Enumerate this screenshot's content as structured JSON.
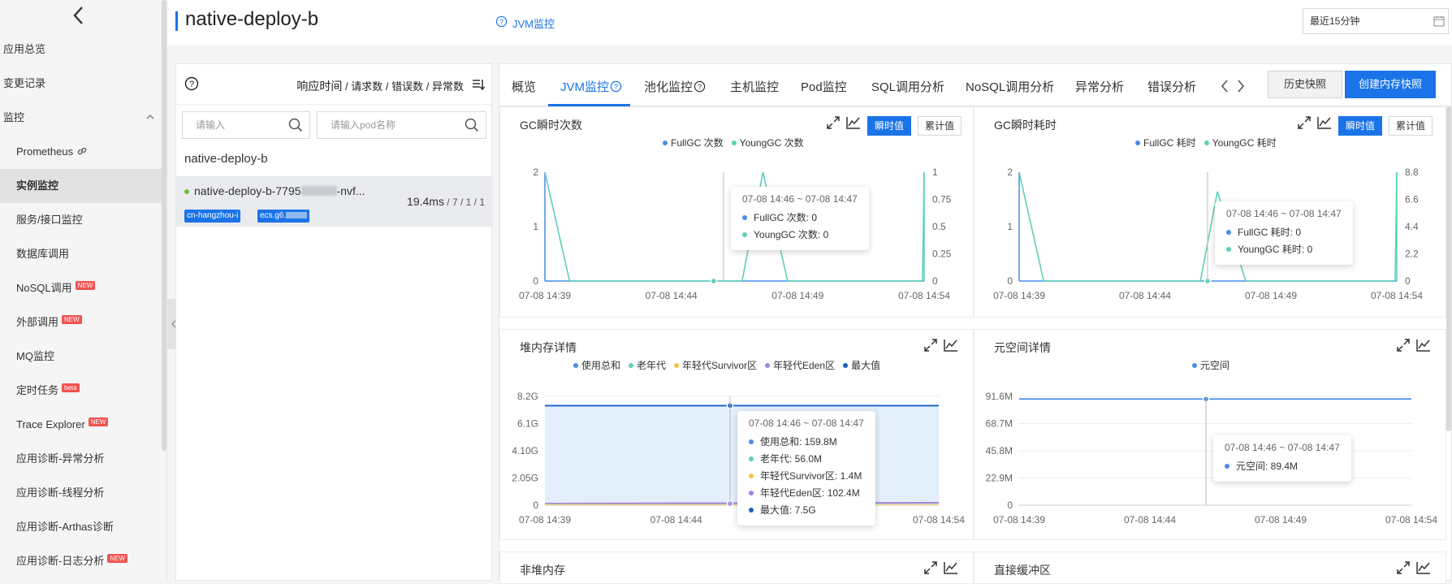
{
  "sidebar": {
    "items": [
      {
        "label": "应用总览",
        "level": "top"
      },
      {
        "label": "变更记录",
        "level": "top"
      },
      {
        "label": "监控",
        "level": "top"
      },
      {
        "label": "Prometheus",
        "level": "sub"
      },
      {
        "label": "实例监控",
        "level": "sub",
        "active": true
      },
      {
        "label": "服务/接口监控",
        "level": "sub"
      },
      {
        "label": "数据库调用",
        "level": "sub"
      },
      {
        "label": "NoSQL调用",
        "level": "sub",
        "badge": "NEW"
      },
      {
        "label": "外部调用",
        "level": "sub",
        "badge": "NEW"
      },
      {
        "label": "MQ监控",
        "level": "sub"
      },
      {
        "label": "定时任务",
        "level": "sub",
        "badge": "beta"
      },
      {
        "label": "Trace Explorer",
        "level": "sub",
        "badge": "NEW"
      },
      {
        "label": "应用诊断-异常分析",
        "level": "sub"
      },
      {
        "label": "应用诊断-线程分析",
        "level": "sub"
      },
      {
        "label": "应用诊断-Arthas诊断",
        "level": "sub"
      },
      {
        "label": "应用诊断-日志分析",
        "level": "sub",
        "badge": "NEW"
      }
    ]
  },
  "header": {
    "title": "native-deploy-b",
    "subtitle": "JVM监控",
    "time_range": "最近15分钟"
  },
  "left": {
    "metrics": {
      "rt": "响应时间",
      "sep": "/",
      "req": "请求数",
      "err": "错误数",
      "exc": "异常数"
    },
    "search_placeholder": "请输入",
    "pod_placeholder": "请输入pod名称",
    "app_name": "native-deploy-b",
    "instance": {
      "name_prefix": "native-deploy-b-7795",
      "name_suffix": "-nvf...",
      "rt": "19.4ms",
      "counts": " / 7 / 1 / 1",
      "tag_region": "cn-hangzhou-i",
      "tag_ecs": "ecs.g6."
    }
  },
  "tabs": [
    "概览",
    "JVM监控",
    "池化监控",
    "主机监控",
    "Pod监控",
    "SQL调用分析",
    "NoSQL调用分析",
    "异常分析",
    "错误分析"
  ],
  "buttons": {
    "history": "历史快照",
    "snapshot": "创建内存快照"
  },
  "toggles": {
    "instant": "瞬时值",
    "cumulative": "累计值"
  },
  "colors": {
    "accent": "#1a74e8",
    "full_gc": "#4a8bea",
    "young_gc": "#5cd0b8",
    "old_gen": "#5cd0b8",
    "survivor": "#f7c244",
    "eden": "#9b87e8",
    "max": "#1660c4"
  },
  "chart_data": [
    {
      "id": "gc-count",
      "type": "line",
      "title": "GC瞬时次数",
      "x": [
        "07-08 14:39",
        "07-08 14:44",
        "07-08 14:49",
        "07-08 14:54"
      ],
      "series": [
        {
          "name": "FullGC 次数",
          "axis": "left",
          "ylim": [
            0,
            2
          ],
          "ticks": [
            "0",
            "1",
            "2"
          ]
        },
        {
          "name": "YoungGC 次数",
          "axis": "right",
          "ylim": [
            0,
            1
          ],
          "ticks": [
            "0",
            "0.25",
            "0.5",
            "0.75",
            "1"
          ]
        }
      ],
      "tooltip": {
        "time": "07-08 14:46 ~ 07-08 14:47",
        "rows": [
          "FullGC 次数:  0",
          "YoungGC 次数:  0"
        ]
      }
    },
    {
      "id": "gc-time",
      "type": "line",
      "title": "GC瞬时耗时",
      "x": [
        "07-08 14:39",
        "07-08 14:44",
        "07-08 14:49",
        "07-08 14:54"
      ],
      "series": [
        {
          "name": "FullGC 耗时",
          "axis": "left",
          "ylim": [
            0,
            2
          ],
          "ticks": [
            "0",
            "1",
            "2"
          ]
        },
        {
          "name": "YoungGC 耗时",
          "axis": "right",
          "ylim": [
            0,
            8.8
          ],
          "ticks": [
            "0",
            "2.2",
            "4.4",
            "6.6",
            "8.8"
          ]
        }
      ],
      "tooltip": {
        "time": "07-08 14:46 ~ 07-08 14:47",
        "rows": [
          "FullGC 耗时:  0",
          "YoungGC 耗时:  0"
        ]
      }
    },
    {
      "id": "heap",
      "type": "area",
      "title": "堆内存详情",
      "x": [
        "07-08 14:39",
        "07-08 14:44",
        "07-08 14:49",
        "07-08 14:54"
      ],
      "yticks": [
        "0",
        "2.05G",
        "4.10G",
        "6.1G",
        "8.2G"
      ],
      "series": [
        {
          "name": "使用总和"
        },
        {
          "name": "老年代"
        },
        {
          "name": "年轻代Survivor区"
        },
        {
          "name": "年轻代Eden区"
        },
        {
          "name": "最大值"
        }
      ],
      "tooltip": {
        "time": "07-08 14:46 ~ 07-08 14:47",
        "rows": [
          "使用总和:  159.8M",
          "老年代:  56.0M",
          "年轻代Survivor区:  1.4M",
          "年轻代Eden区:  102.4M",
          "最大值:  7.5G"
        ]
      }
    },
    {
      "id": "metaspace",
      "type": "line",
      "title": "元空间详情",
      "x": [
        "07-08 14:39",
        "07-08 14:44",
        "07-08 14:49",
        "07-08 14:54"
      ],
      "yticks": [
        "0",
        "22.9M",
        "45.8M",
        "68.7M",
        "91.6M"
      ],
      "series": [
        {
          "name": "元空间"
        }
      ],
      "tooltip": {
        "time": "07-08 14:46 ~ 07-08 14:47",
        "rows": [
          "元空间:  89.4M"
        ]
      }
    },
    {
      "id": "nonheap",
      "title": "非堆内存"
    },
    {
      "id": "direct",
      "title": "直接缓冲区"
    }
  ]
}
